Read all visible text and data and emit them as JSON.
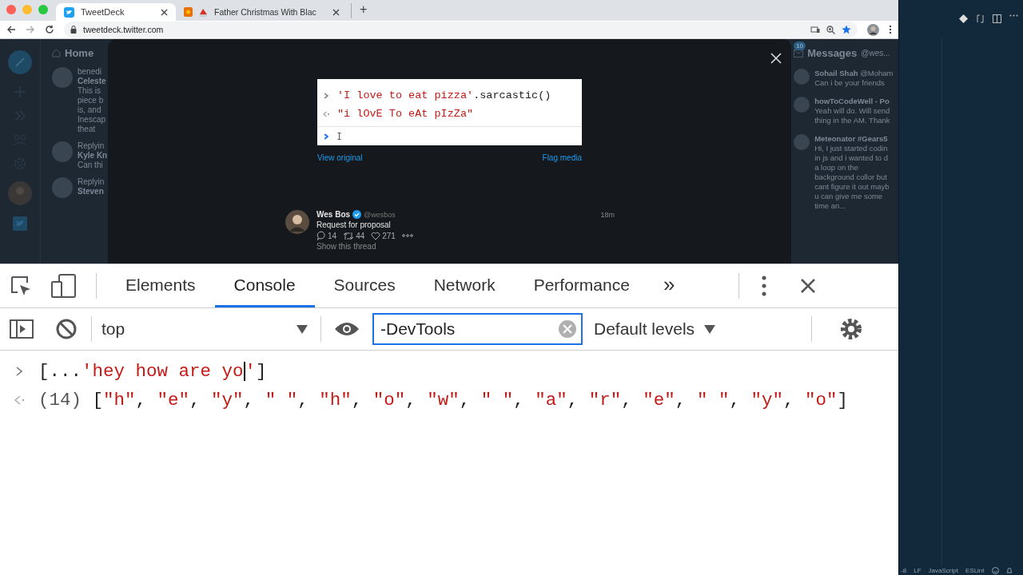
{
  "browser": {
    "tabs": [
      {
        "title": "TweetDeck",
        "selected": true
      },
      {
        "title": "Father Christmas With Blac",
        "selected": false
      }
    ],
    "new_tab": "+",
    "url": "tweetdeck.twitter.com"
  },
  "tweetdeck": {
    "home_column": {
      "title": "Home",
      "tweets": [
        {
          "context": "benedi",
          "name": "Celeste",
          "lines": [
            "This is",
            "piece b",
            "is, and",
            "Inescap",
            "theat"
          ]
        },
        {
          "context": "Replyin",
          "name": "Kyle Kn",
          "lines": [
            "Can thi"
          ]
        },
        {
          "context": "Replyin",
          "name": "Steven"
        }
      ]
    },
    "messages_column": {
      "title": "Messages",
      "handle": "@wes...",
      "badge": "10",
      "messages": [
        {
          "name": "Sohail Shah",
          "handle": "@Moham",
          "lines": [
            "Can i be your friends"
          ]
        },
        {
          "name": "howToCodeWell - Po",
          "lines": [
            "Yeah will do. Will send",
            "thing in the AM. Thank"
          ]
        },
        {
          "name": "Meteonator #Gears5",
          "lines": [
            "Hi, I just started codin",
            "in js and i wanted to d",
            "a loop on the",
            "background collor but",
            "cant figure it out mayb",
            "u can give me some",
            "time an..."
          ]
        }
      ]
    },
    "modal": {
      "media_lines": [
        {
          "kind": "input",
          "tokens": [
            {
              "text": "'I love to eat pizza'",
              "kind": "string"
            },
            {
              "text": ".sarcastic()",
              "kind": "punct"
            }
          ]
        },
        {
          "kind": "output",
          "tokens": [
            {
              "text": "\"i lOvE To eAt pIzZa\"",
              "kind": "string"
            }
          ]
        },
        {
          "kind": "prompt"
        }
      ],
      "view_original": "View original",
      "flag_media": "Flag media",
      "tweet": {
        "name": "Wes Bos",
        "verified": true,
        "handle": "@wesbos",
        "time": "18m",
        "text": "Request for proposal",
        "replies": "14",
        "retweets": "44",
        "likes": "271",
        "show_thread": "Show this thread"
      }
    }
  },
  "devtools": {
    "tabs": [
      {
        "label": "Elements",
        "selected": false
      },
      {
        "label": "Console",
        "selected": true
      },
      {
        "label": "Sources",
        "selected": false
      },
      {
        "label": "Network",
        "selected": false
      },
      {
        "label": "Performance",
        "selected": false
      }
    ],
    "more_tabs": "»",
    "context": "top",
    "filter": {
      "value": "-DevTools"
    },
    "levels": "Default levels",
    "console": [
      {
        "kind": "input",
        "tokens": [
          {
            "text": "[...",
            "kind": "punct"
          },
          {
            "text": "'hey how are yo",
            "kind": "string",
            "cursor": true
          },
          {
            "text": "'",
            "kind": "string"
          },
          {
            "text": "]",
            "kind": "punct"
          }
        ]
      },
      {
        "kind": "output",
        "tokens": [
          {
            "text": "(14) ",
            "kind": "count"
          },
          {
            "text": "[",
            "kind": "punct"
          },
          {
            "text": "\"h\"",
            "kind": "string"
          },
          {
            "text": ", ",
            "kind": "punct"
          },
          {
            "text": "\"e\"",
            "kind": "string"
          },
          {
            "text": ", ",
            "kind": "punct"
          },
          {
            "text": "\"y\"",
            "kind": "string"
          },
          {
            "text": ", ",
            "kind": "punct"
          },
          {
            "text": "\" \"",
            "kind": "string"
          },
          {
            "text": ", ",
            "kind": "punct"
          },
          {
            "text": "\"h\"",
            "kind": "string"
          },
          {
            "text": ", ",
            "kind": "punct"
          },
          {
            "text": "\"o\"",
            "kind": "string"
          },
          {
            "text": ", ",
            "kind": "punct"
          },
          {
            "text": "\"w\"",
            "kind": "string"
          },
          {
            "text": ", ",
            "kind": "punct"
          },
          {
            "text": "\" \"",
            "kind": "string"
          },
          {
            "text": ", ",
            "kind": "punct"
          },
          {
            "text": "\"a\"",
            "kind": "string"
          },
          {
            "text": ", ",
            "kind": "punct"
          },
          {
            "text": "\"r\"",
            "kind": "string"
          },
          {
            "text": ", ",
            "kind": "punct"
          },
          {
            "text": "\"e\"",
            "kind": "string"
          },
          {
            "text": ", ",
            "kind": "punct"
          },
          {
            "text": "\" \"",
            "kind": "string"
          },
          {
            "text": ", ",
            "kind": "punct"
          },
          {
            "text": "\"y\"",
            "kind": "string"
          },
          {
            "text": ", ",
            "kind": "punct"
          },
          {
            "text": "\"o\"",
            "kind": "string"
          },
          {
            "text": "]",
            "kind": "punct"
          }
        ]
      }
    ]
  },
  "editor": {
    "status_bar": [
      "-8",
      "LF",
      "JavaScript",
      "ESLint"
    ]
  }
}
